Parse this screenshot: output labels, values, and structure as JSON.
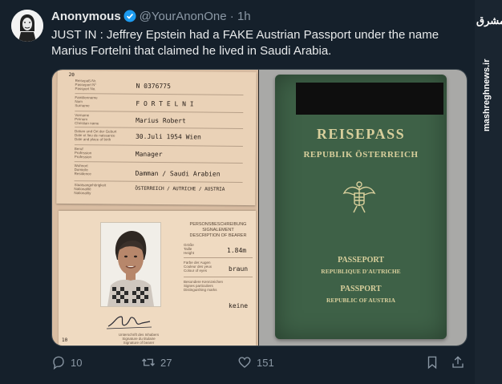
{
  "tweet": {
    "author_name": "Anonymous",
    "handle": "@YourAnonOne",
    "separator": "·",
    "time": "1h",
    "text": "JUST IN : Jeffrey Epstein had a FAKE Austrian Passport under the name Marius Fortelni that claimed he lived in Saudi Arabia.",
    "verified_color": "#1d9bf0"
  },
  "passport_page": {
    "labels": {
      "passport_no": "Reisepaß-Nr.\nPasseport N°\nPassport No.",
      "surname": "Familienname\nNom\nSurname",
      "given": "Vorname\nPrénom\nChristian name",
      "birth": "Datum und Ort der Geburt\nDate et lieu de naissance\nDate and place of birth",
      "profession": "Beruf\nProfession\nProfession",
      "residence": "Wohnort\nDomicile\nResidence",
      "nationality": "Staatsangehörigkeit\nNationalité\nNationality"
    },
    "corner_number": "20",
    "passport_number": "N 0376775",
    "surname": "F O R T E L N I",
    "given_name": "Marius Robert",
    "birth": "30.Juli 1954   Wien",
    "profession": "Manager",
    "residence": "Damman / Saudi Arabien",
    "nationality": "ÖSTERREICH  /  AUTRICHE  /  AUSTRIA",
    "description_heading": "PERSONSBESCHREIBUNG\nSIGNALEMENT\nDESCRIPTION OF BEARER",
    "height_label": "Größe\nTaille\nHeight",
    "height_value": "1.84m",
    "eyes_label": "Farbe der Augen\nCouleur des yeux\nColour of eyes",
    "eyes_value": "braun",
    "marks_label": "Besondere Kennzeichen\nSignes particuliers\nDistinguishing marks",
    "marks_value": "keine",
    "signature_caption": "Unterschrift des Inhabers\nSignature du titulaire\nSignature of bearer",
    "page_number": "10"
  },
  "passport_cover": {
    "title": "REISEPASS",
    "subtitle": "REPUBLIK ÖSTERREICH",
    "fr_title": "PASSEPORT",
    "fr_sub": "REPUBLIQUE D'AUTRICHE",
    "en_title": "PASSPORT",
    "en_sub": "REPUBLIC OF AUSTRIA",
    "gold_color": "#d8cf9c"
  },
  "actions": {
    "replies": "10",
    "retweets": "27",
    "likes": "151"
  },
  "watermark": {
    "logo": "مشرق",
    "site": "mashreghnews.ir"
  }
}
